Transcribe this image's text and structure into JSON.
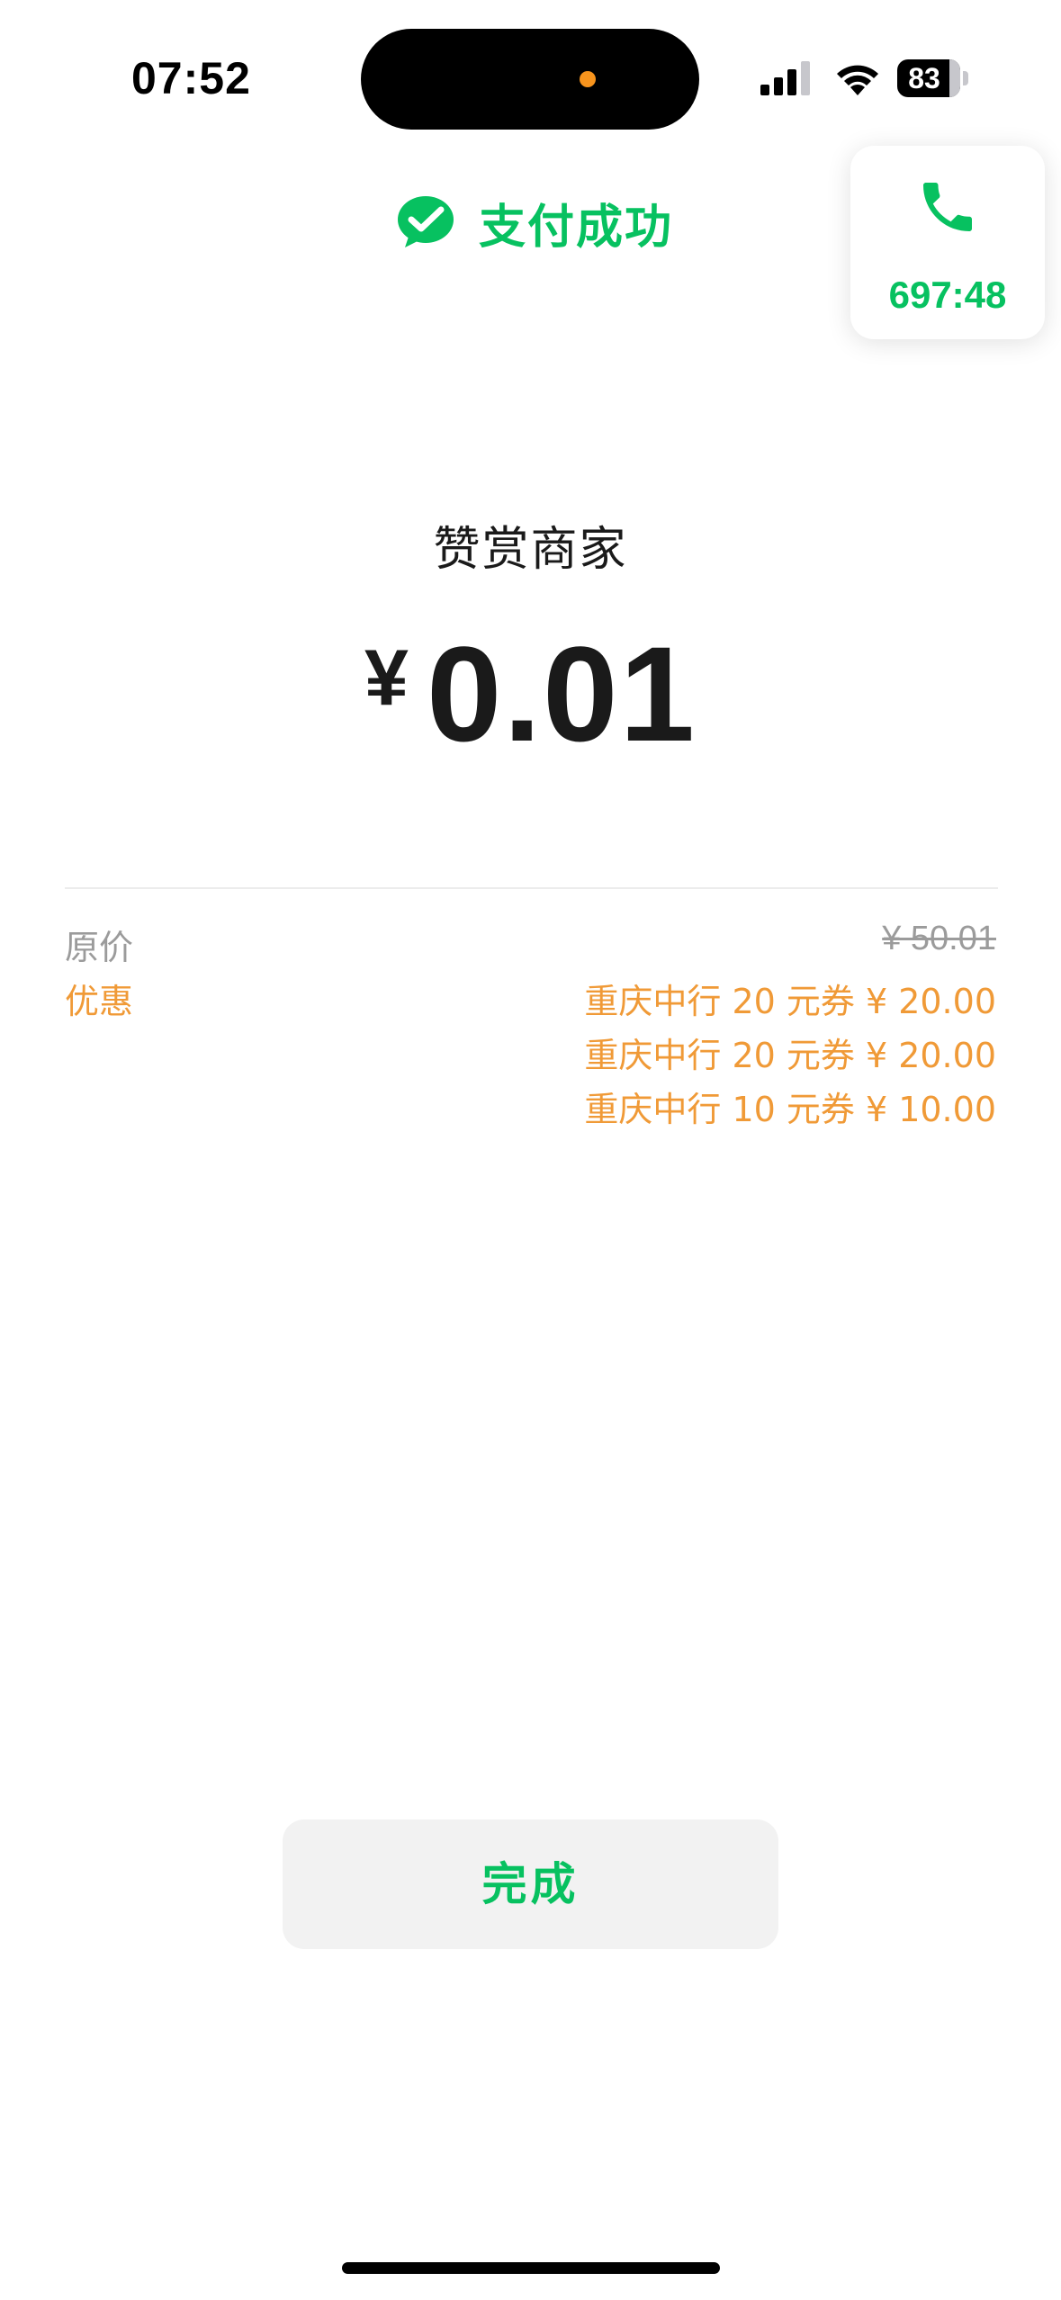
{
  "status_bar": {
    "time": "07:52",
    "battery": "83"
  },
  "call_widget": {
    "timer": "697:48",
    "icon": "phone-icon"
  },
  "header": {
    "title": "支付成功",
    "icon": "wechat-pay-icon"
  },
  "payment": {
    "merchant": "赞赏商家",
    "currency": "¥",
    "amount": "0.01"
  },
  "details": {
    "original_label": "原价",
    "original_value": "¥ 50.01",
    "discount_label": "优惠",
    "discounts": [
      "重庆中行 20 元券 ¥ 20.00",
      "重庆中行 20 元券 ¥ 20.00",
      "重庆中行 10 元券 ¥ 10.00"
    ]
  },
  "actions": {
    "done_label": "完成"
  },
  "colors": {
    "accent": "#07c160",
    "discount": "#f09a37",
    "muted": "#9b9b9b"
  }
}
